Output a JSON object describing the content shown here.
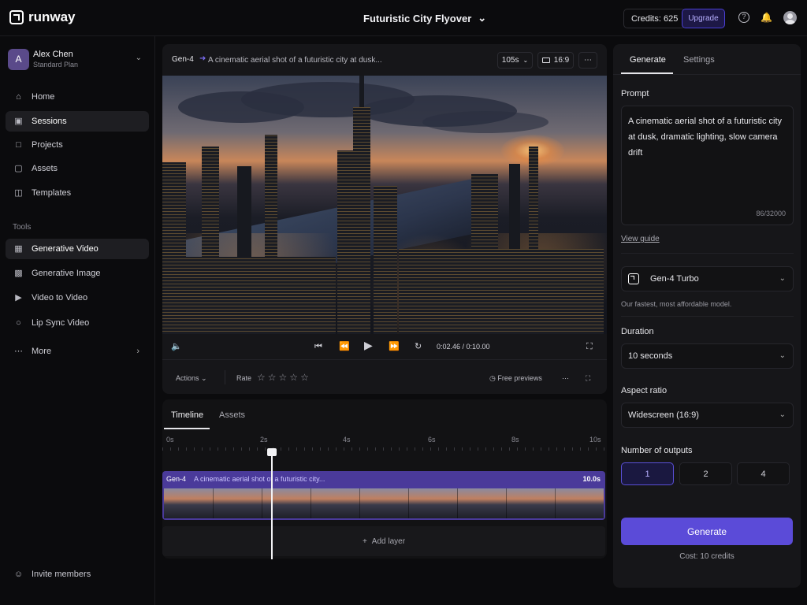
{
  "brand": {
    "name": "runway"
  },
  "project": {
    "title": "Futuristic City Flyover"
  },
  "account": {
    "credits": "Credits: 625",
    "upgrade": "Upgrade"
  },
  "user": {
    "initial": "A",
    "name": "Alex Chen",
    "plan": "Standard Plan"
  },
  "sidebar": {
    "nav": [
      {
        "label": "Home",
        "icon": "home-icon"
      },
      {
        "label": "Sessions",
        "icon": "sessions-icon"
      },
      {
        "label": "Projects",
        "icon": "folder-icon"
      },
      {
        "label": "Assets",
        "icon": "assets-icon"
      },
      {
        "label": "Templates",
        "icon": "templates-icon"
      }
    ],
    "tools_label": "Tools",
    "tools": [
      {
        "label": "Generative Video",
        "icon": "video-gen-icon"
      },
      {
        "label": "Generative Image",
        "icon": "image-icon"
      },
      {
        "label": "Video to Video",
        "icon": "video-icon"
      },
      {
        "label": "Lip Sync Video",
        "icon": "headphones-icon"
      },
      {
        "label": "More",
        "icon": "more-icon"
      }
    ],
    "invite": "Invite members"
  },
  "player": {
    "model": "Gen-4",
    "prompt_crumb": "A cinematic aerial shot of a futuristic city at dusk...",
    "length": "105s",
    "ratio": "16:9",
    "time": "0:02.46 / 0:10.00",
    "actions": "Actions",
    "rate": "Rate",
    "free_previews": "Free previews"
  },
  "timeline": {
    "tabs": [
      "Timeline",
      "Assets"
    ],
    "ticks": [
      "0s",
      "2s",
      "4s",
      "6s",
      "8s",
      "10s"
    ],
    "clip": {
      "model": "Gen-4",
      "prompt": "A cinematic aerial shot of a futuristic city...",
      "duration": "10.0s"
    },
    "add_layer": "Add layer"
  },
  "panel": {
    "tabs": [
      "Generate",
      "Settings"
    ],
    "prompt_label": "Prompt",
    "prompt_text": "A cinematic aerial shot of a futuristic city at dusk, dramatic lighting, slow camera drift",
    "char_count": "86/32000",
    "view_guide": "View guide",
    "model": "Gen-4 Turbo",
    "model_helper": "Our fastest, most affordable model.",
    "duration_label": "Duration",
    "duration": "10 seconds",
    "aspect_label": "Aspect ratio",
    "aspect": "Widescreen (16:9)",
    "outputs_label": "Number of outputs",
    "outputs": [
      "1",
      "2",
      "4"
    ],
    "generate": "Generate",
    "cost": "Cost: 10 credits"
  },
  "colors": {
    "accent": "#5b4bd8",
    "clip": "#4a3a9a",
    "background": "#0b0b0d"
  }
}
